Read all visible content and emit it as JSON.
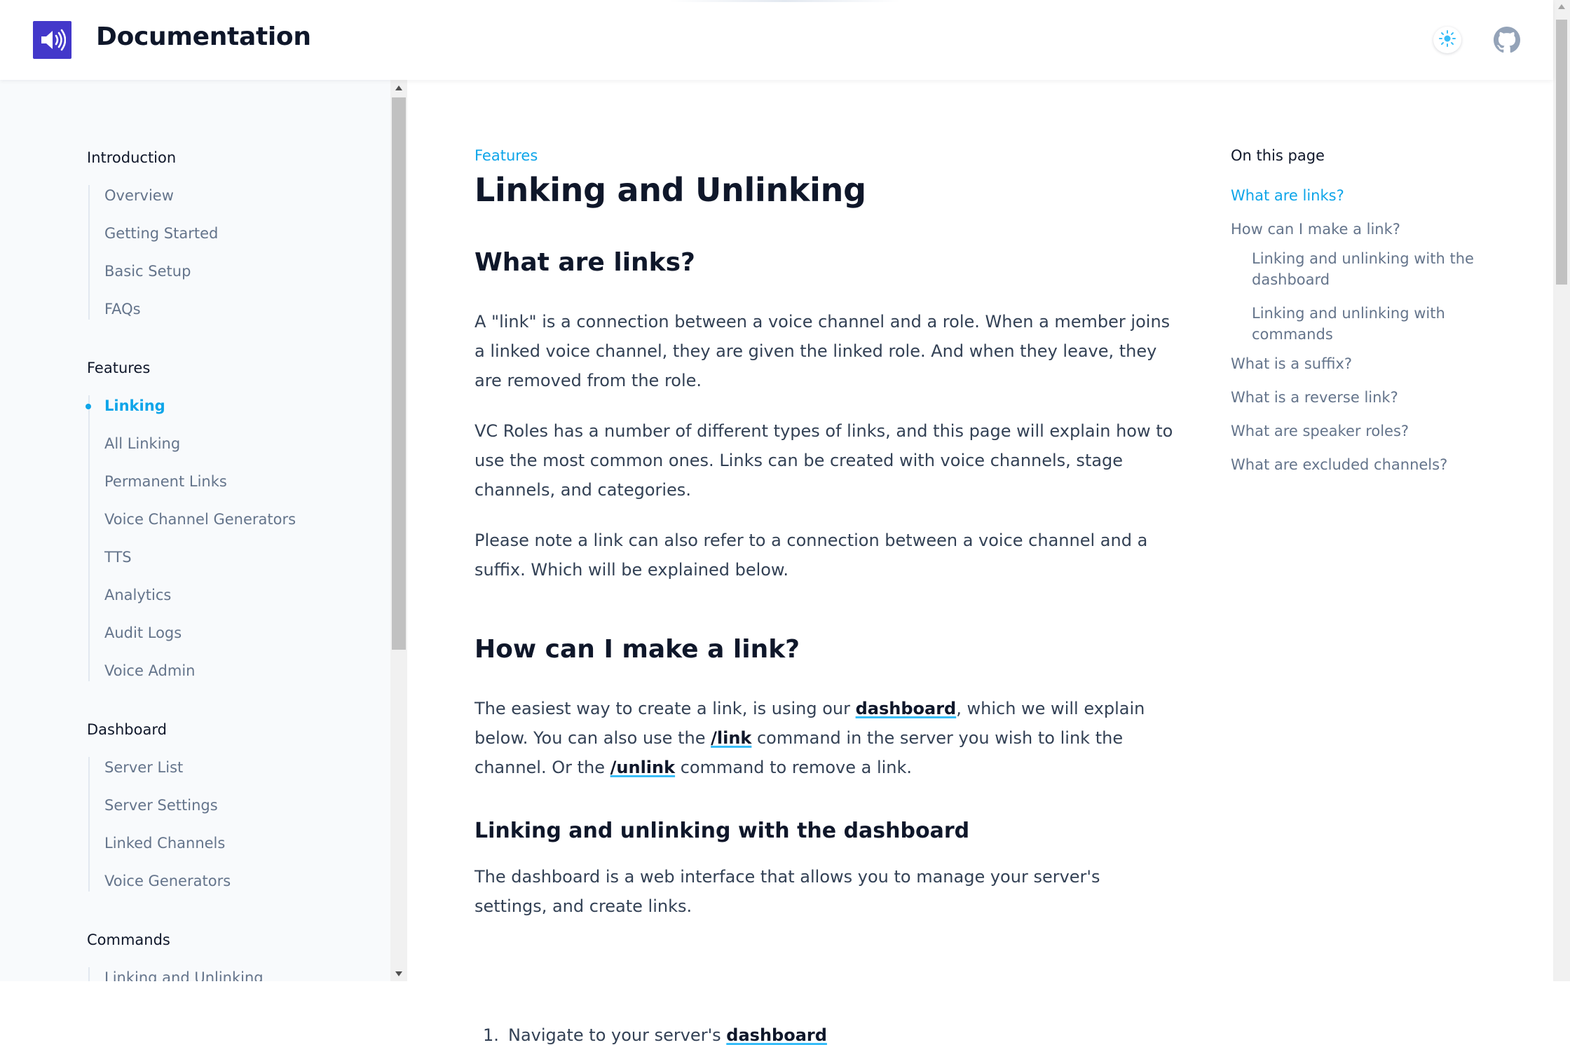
{
  "header": {
    "brand": "Documentation",
    "logo_icon": "speaker-icon",
    "theme_icon": "sun-icon",
    "github_icon": "github-icon",
    "accent_color": "#4338ca"
  },
  "sidebar": {
    "sections": [
      {
        "title": "Introduction",
        "items": [
          "Overview",
          "Getting Started",
          "Basic Setup",
          "FAQs"
        ]
      },
      {
        "title": "Features",
        "items": [
          "Linking",
          "All Linking",
          "Permanent Links",
          "Voice Channel Generators",
          "TTS",
          "Analytics",
          "Audit Logs",
          "Voice Admin"
        ],
        "active": "Linking"
      },
      {
        "title": "Dashboard",
        "items": [
          "Server List",
          "Server Settings",
          "Linked Channels",
          "Voice Generators"
        ]
      },
      {
        "title": "Commands",
        "items": [
          "Linking and Unlinking"
        ]
      }
    ]
  },
  "main": {
    "eyebrow": "Features",
    "title": "Linking and Unlinking",
    "s1": {
      "heading": "What are links?",
      "p1": "A \"link\" is a connection between a voice channel and a role. When a member joins a linked voice channel, they are given the linked role. And when they leave, they are removed from the role.",
      "p2": "VC Roles has a number of different types of links, and this page will explain how to use the most common ones. Links can be created with voice channels, stage channels, and categories.",
      "p3": "Please note a link can also refer to a connection between a voice channel and a suffix. Which will be explained below."
    },
    "s2": {
      "heading": "How can I make a link?",
      "p1_a": "The easiest way to create a link, is using our ",
      "p1_link1": "dashboard",
      "p1_b": ", which we will explain below. You can also use the ",
      "p1_link2": "/link",
      "p1_c": " command in the server you wish to link the channel. Or the ",
      "p1_link3": "/unlink",
      "p1_d": " command to remove a link."
    },
    "s3": {
      "heading": "Linking and unlinking with the dashboard",
      "p1": "The dashboard is a web interface that allows you to manage your server's settings, and create links.",
      "step1_num": "1.",
      "step1_text": "Navigate to your server's ",
      "step1_link": "dashboard"
    }
  },
  "toc": {
    "title": "On this page",
    "links": [
      "What are links?",
      "How can I make a link?",
      "Linking and unlinking with the dashboard",
      "Linking and unlinking with commands",
      "What is a suffix?",
      "What is a reverse link?",
      "What are speaker roles?",
      "What are excluded channels?"
    ]
  }
}
